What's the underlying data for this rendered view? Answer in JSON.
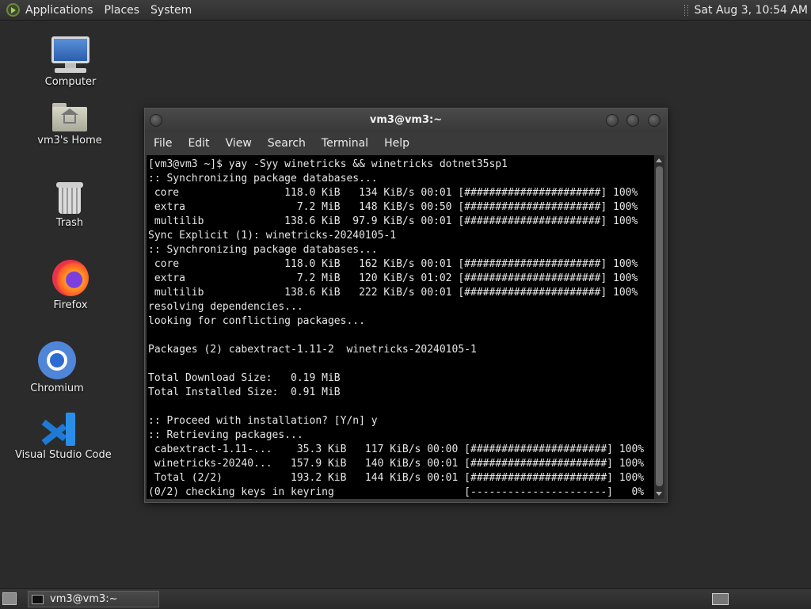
{
  "top_panel": {
    "menus": [
      "Applications",
      "Places",
      "System"
    ],
    "clock": "Sat Aug  3, 10:54 AM"
  },
  "desktop_icons": [
    {
      "label": "Computer",
      "icon": "computer-icon"
    },
    {
      "label": "vm3's Home",
      "icon": "home-folder-icon"
    },
    {
      "label": "Trash",
      "icon": "trash-icon"
    },
    {
      "label": "Firefox",
      "icon": "firefox-icon"
    },
    {
      "label": "Chromium",
      "icon": "chromium-icon"
    },
    {
      "label": "Visual Studio Code",
      "icon": "vscode-icon"
    }
  ],
  "terminal": {
    "title": "vm3@vm3:~",
    "menu": [
      "File",
      "Edit",
      "View",
      "Search",
      "Terminal",
      "Help"
    ],
    "lines": [
      "[vm3@vm3 ~]$ yay -Syy winetricks && winetricks dotnet35sp1",
      ":: Synchronizing package databases...",
      " core                 118.0 KiB   134 KiB/s 00:01 [######################] 100%",
      " extra                  7.2 MiB   148 KiB/s 00:50 [######################] 100%",
      " multilib             138.6 KiB  97.9 KiB/s 00:01 [######################] 100%",
      "Sync Explicit (1): winetricks-20240105-1",
      ":: Synchronizing package databases...",
      " core                 118.0 KiB   162 KiB/s 00:01 [######################] 100%",
      " extra                  7.2 MiB   120 KiB/s 01:02 [######################] 100%",
      " multilib             138.6 KiB   222 KiB/s 00:01 [######################] 100%",
      "resolving dependencies...",
      "looking for conflicting packages...",
      "",
      "Packages (2) cabextract-1.11-2  winetricks-20240105-1",
      "",
      "Total Download Size:   0.19 MiB",
      "Total Installed Size:  0.91 MiB",
      "",
      ":: Proceed with installation? [Y/n] y",
      ":: Retrieving packages...",
      " cabextract-1.11-...    35.3 KiB   117 KiB/s 00:00 [######################] 100%",
      " winetricks-20240...   157.9 KiB   140 KiB/s 00:01 [######################] 100%",
      " Total (2/2)           193.2 KiB   144 KiB/s 00:01 [######################] 100%",
      "(0/2) checking keys in keyring                     [----------------------]   0%"
    ]
  },
  "taskbar": {
    "window_button": "vm3@vm3:~"
  }
}
